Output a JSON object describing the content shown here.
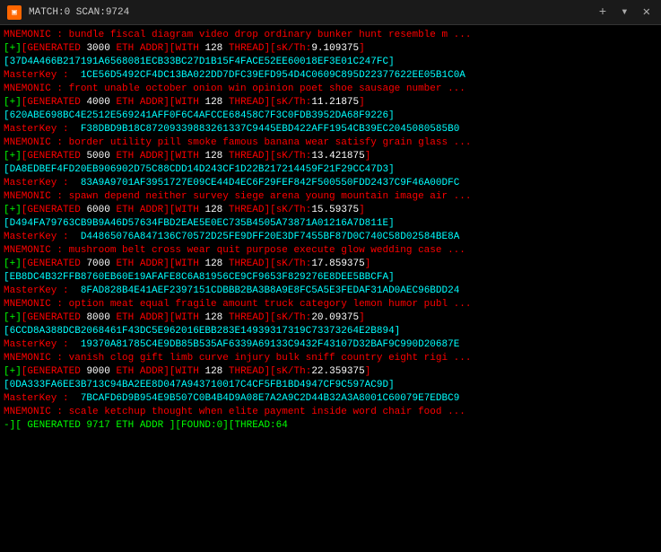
{
  "titlebar": {
    "icon": "▣",
    "title": "MATCH:0 SCAN:9724",
    "close_label": "✕",
    "plus_label": "+",
    "chevron_label": "▾"
  },
  "lines": [
    {
      "type": "mnemonic",
      "text": "MNEMONIC : bundle fiscal diagram video drop ordinary bunker hunt resemble m ..."
    },
    {
      "type": "generated",
      "text": "[+][GENERATED 3000 ETH ADDR][WITH 128 THREAD][sK/Th:9.109375]"
    },
    {
      "type": "hash",
      "text": "[37D4A466B217191A6568081ECB33BC27D1B15F4FACE52EE60018EF3E01C247FC]"
    },
    {
      "type": "masterkey",
      "text": "MasterKey :  1CE56D5492CF4DC13BA022DD7DFC39EFD954D4C0609C895D22377622EE05B1C0A"
    },
    {
      "type": "mnemonic",
      "text": "MNEMONIC : front unable october onion win opinion poet shoe sausage number ..."
    },
    {
      "type": "generated",
      "text": "[+][GENERATED 4000 ETH ADDR][WITH 128 THREAD][sK/Th:11.21875]"
    },
    {
      "type": "hash",
      "text": "[620ABE698BC4E2512E569241AFF0F6C4AFCCE68458C7F3C0FDB3952DA68F9226]"
    },
    {
      "type": "masterkey",
      "text": "MasterKey :  F38DBD9B18C87209339883261337C9445EBD422AFF1954CB39EC2045080585B0"
    },
    {
      "type": "mnemonic",
      "text": "MNEMONIC : border utility pill smoke famous banana wear satisfy grain glass ..."
    },
    {
      "type": "generated",
      "text": "[+][GENERATED 5000 ETH ADDR][WITH 128 THREAD][sK/Th:13.421875]"
    },
    {
      "type": "hash",
      "text": "[DA8EDBEF4FD20EB906902D75C88CDD14D243CF1D22B217214459F21F29CC47D3]"
    },
    {
      "type": "masterkey",
      "text": "MasterKey :  83A9A9701AF3951727E09CE44D4EC6F29FEF842F500550FDD2437C9F46A00DFC"
    },
    {
      "type": "mnemonic",
      "text": "MNEMONIC : spawn depend neither survey siege arena young mountain image air ..."
    },
    {
      "type": "generated",
      "text": "[+][GENERATED 6000 ETH ADDR][WITH 128 THREAD][sK/Th:15.59375]"
    },
    {
      "type": "hash",
      "text": "[D494FA79763CB9B9A46D57634FBD2EAE5E0EC735B4505A73871A01216A7D811E]"
    },
    {
      "type": "masterkey",
      "text": "MasterKey :  D44865076A847136C70572D25FE9DFF20E3DF7455BF87D0C740C58D02584BE8A"
    },
    {
      "type": "mnemonic",
      "text": "MNEMONIC : mushroom belt cross wear quit purpose execute glow wedding case ..."
    },
    {
      "type": "generated",
      "text": "[+][GENERATED 7000 ETH ADDR][WITH 128 THREAD][sK/Th:17.859375]"
    },
    {
      "type": "hash",
      "text": "[EB8DC4B32FFB8760EB60E19AFAFE8C6A81956CE9CF9653F829276E8DEE5BBCFA]"
    },
    {
      "type": "masterkey",
      "text": "MasterKey :  8FAD828B4E41AEF2397151CDBBB2BA3B8A9E8FC5A5E3FEDAF31AD0AEC96BDD24"
    },
    {
      "type": "mnemonic",
      "text": "MNEMONIC : option meat equal fragile amount truck category lemon humor publ ..."
    },
    {
      "type": "generated",
      "text": "[+][GENERATED 8000 ETH ADDR][WITH 128 THREAD][sK/Th:20.09375]"
    },
    {
      "type": "hash",
      "text": "[6CCD8A388DCB2068461F43DC5E962016EBB283E14939317319C73373264E2B894]"
    },
    {
      "type": "masterkey",
      "text": "MasterKey :  19370A81785C4E9DB85B535AF6339A69133C9432F43107D32BAF9C990D20687E"
    },
    {
      "type": "mnemonic",
      "text": "MNEMONIC : vanish clog gift limb curve injury bulk sniff country eight rigi ..."
    },
    {
      "type": "generated",
      "text": "[+][GENERATED 9000 ETH ADDR][WITH 128 THREAD][sK/Th:22.359375]"
    },
    {
      "type": "hash",
      "text": "[0DA333FA6EE3B713C94BA2EE8D047A943710017C4CF5FB1BD4947CF9C597AC9D]"
    },
    {
      "type": "masterkey",
      "text": "MasterKey :  7BCAFD6D9B954E9B507C0B4B4D9A08E7A2A9C2D44B32A3A8001C60079E7EDBC9"
    },
    {
      "type": "mnemonic",
      "text": "MNEMONIC : scale ketchup thought when elite payment inside word chair food ..."
    },
    {
      "type": "status",
      "text": "-][ GENERATED 9717 ETH ADDR ][FOUND:0][THREAD:64"
    }
  ]
}
